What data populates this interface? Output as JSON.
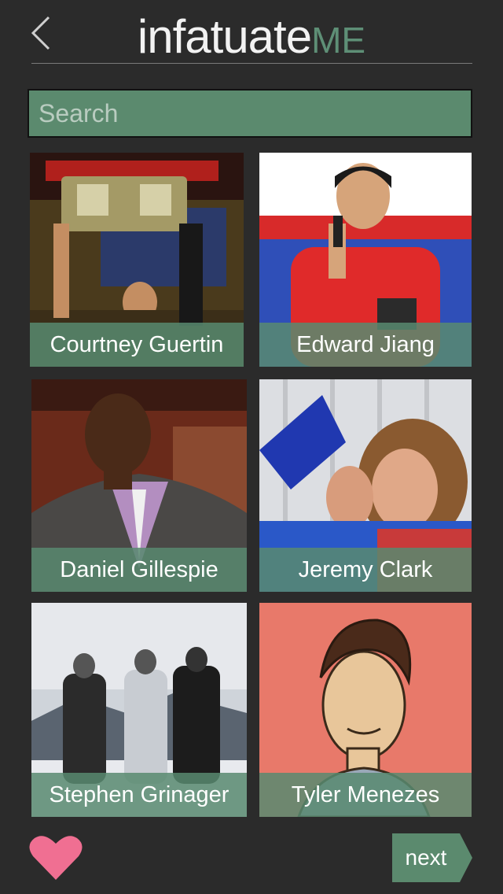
{
  "header": {
    "title_main": "infatuate",
    "title_accent": "ME"
  },
  "search": {
    "placeholder": "Search"
  },
  "people": [
    {
      "name": "Courtney Guertin"
    },
    {
      "name": "Edward Jiang"
    },
    {
      "name": "Daniel Gillespie"
    },
    {
      "name": "Jeremy Clark"
    },
    {
      "name": "Stephen Grinager"
    },
    {
      "name": "Tyler Menezes"
    }
  ],
  "footer": {
    "next_label": "next"
  },
  "colors": {
    "accent": "#5b8a6e",
    "heart": "#f06f92",
    "background": "#2b2b2b"
  }
}
